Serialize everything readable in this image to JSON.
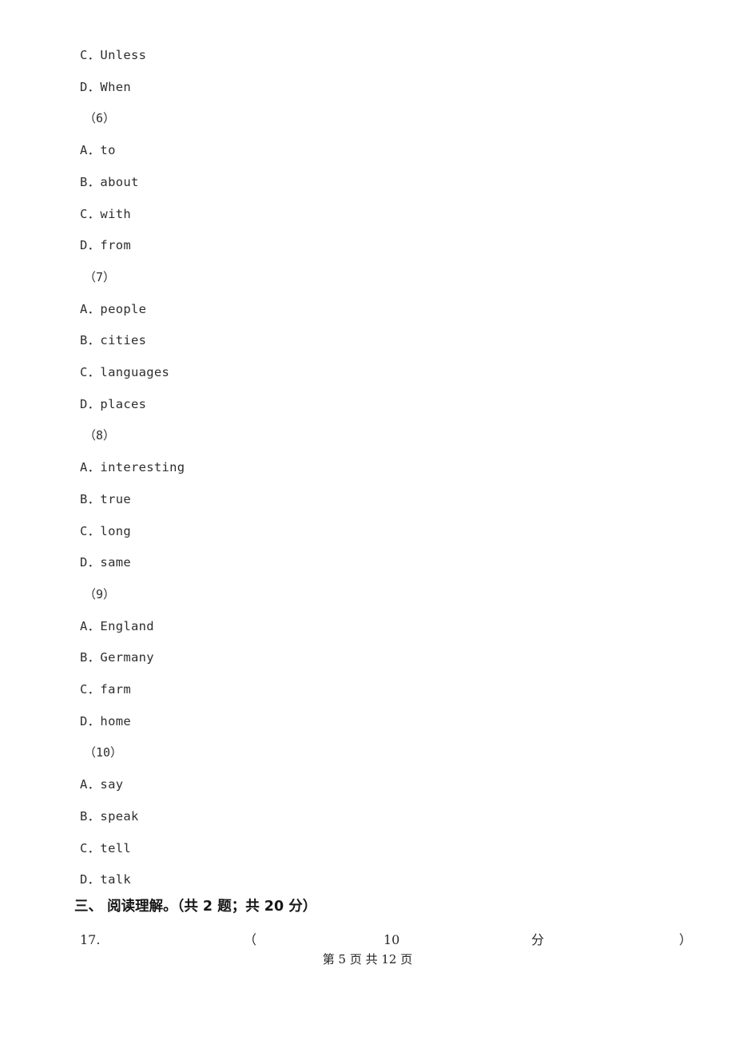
{
  "document": {
    "page_footer": "第 5 页 共 12 页",
    "lines": [
      {
        "type": "option",
        "text": "C．Unless"
      },
      {
        "type": "option",
        "text": "D．When"
      },
      {
        "type": "question",
        "text": "（6）"
      },
      {
        "type": "option",
        "text": "A．to"
      },
      {
        "type": "option",
        "text": "B．about"
      },
      {
        "type": "option",
        "text": "C．with"
      },
      {
        "type": "option",
        "text": "D．from"
      },
      {
        "type": "question",
        "text": "（7）"
      },
      {
        "type": "option",
        "text": "A．people"
      },
      {
        "type": "option",
        "text": "B．cities"
      },
      {
        "type": "option",
        "text": "C．languages"
      },
      {
        "type": "option",
        "text": "D．places"
      },
      {
        "type": "question",
        "text": "（8）"
      },
      {
        "type": "option",
        "text": "A．interesting"
      },
      {
        "type": "option",
        "text": "B．true"
      },
      {
        "type": "option",
        "text": "C．long"
      },
      {
        "type": "option",
        "text": "D．same"
      },
      {
        "type": "question",
        "text": "（9）"
      },
      {
        "type": "option",
        "text": "A．England"
      },
      {
        "type": "option",
        "text": "B．Germany"
      },
      {
        "type": "option",
        "text": "C．farm"
      },
      {
        "type": "option",
        "text": "D．home"
      },
      {
        "type": "question",
        "text": "（10）"
      },
      {
        "type": "option",
        "text": "A．say"
      },
      {
        "type": "option",
        "text": "B．speak"
      },
      {
        "type": "option",
        "text": "C．tell"
      },
      {
        "type": "option",
        "text": "D．talk"
      }
    ],
    "section_heading": "三、 阅读理解。（共 2 题；共 20 分）",
    "question_row": {
      "number": "17.",
      "paren_open": "（",
      "score": "10",
      "score_unit": "分",
      "paren_close": "）"
    }
  }
}
